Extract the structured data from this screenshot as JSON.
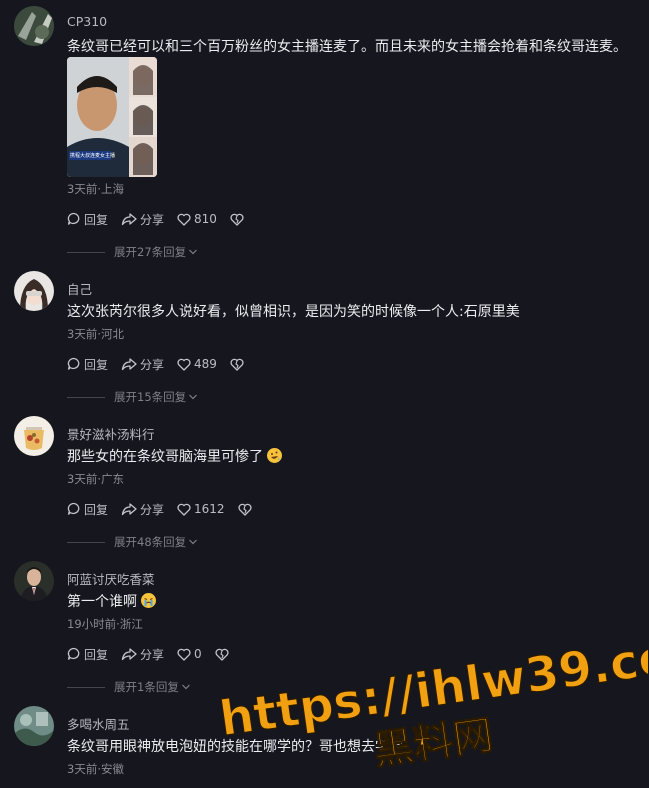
{
  "comments": [
    {
      "username": "CP310",
      "text": "条纹哥已经可以和三个百万粉丝的女主播连麦了。而且未来的女主播会抢着和条纹哥连麦。",
      "meta": "3天前·上海",
      "reply_label": "回复",
      "share_label": "分享",
      "likes": "810",
      "more_replies": "展开27条回复",
      "image_caption": "携程大叔连麦女主播"
    },
    {
      "username": "自己",
      "text": "这次张芮尔很多人说好看，似曾相识，是因为笑的时候像一个人:石原里美",
      "meta": "3天前·河北",
      "reply_label": "回复",
      "share_label": "分享",
      "likes": "489",
      "more_replies": "展开15条回复"
    },
    {
      "username": "景好滋补汤料行",
      "text": "那些女的在条纹哥脑海里可惨了",
      "meta": "3天前·广东",
      "reply_label": "回复",
      "share_label": "分享",
      "likes": "1612",
      "more_replies": "展开48条回复",
      "emoji_icon": "rolling-laughing-emoji"
    },
    {
      "username": "阿蓝讨厌吃香菜",
      "text": "第一个谁啊",
      "meta": "19小时前·浙江",
      "reply_label": "回复",
      "share_label": "分享",
      "likes": "0",
      "more_replies": "展开1条回复",
      "emoji_icon": "crying-emoji"
    },
    {
      "username": "多喝水周五",
      "text": "条纹哥用眼神放电泡妞的技能在哪学的？哥也想去学学",
      "meta": "3天前·安徽"
    }
  ],
  "watermark": {
    "url": "https://ihlw39.com",
    "name": "黑料网"
  },
  "colors": {
    "background": "#16161e",
    "watermark_orange": "#f0a010",
    "secondary_text": "#8a8a93"
  }
}
